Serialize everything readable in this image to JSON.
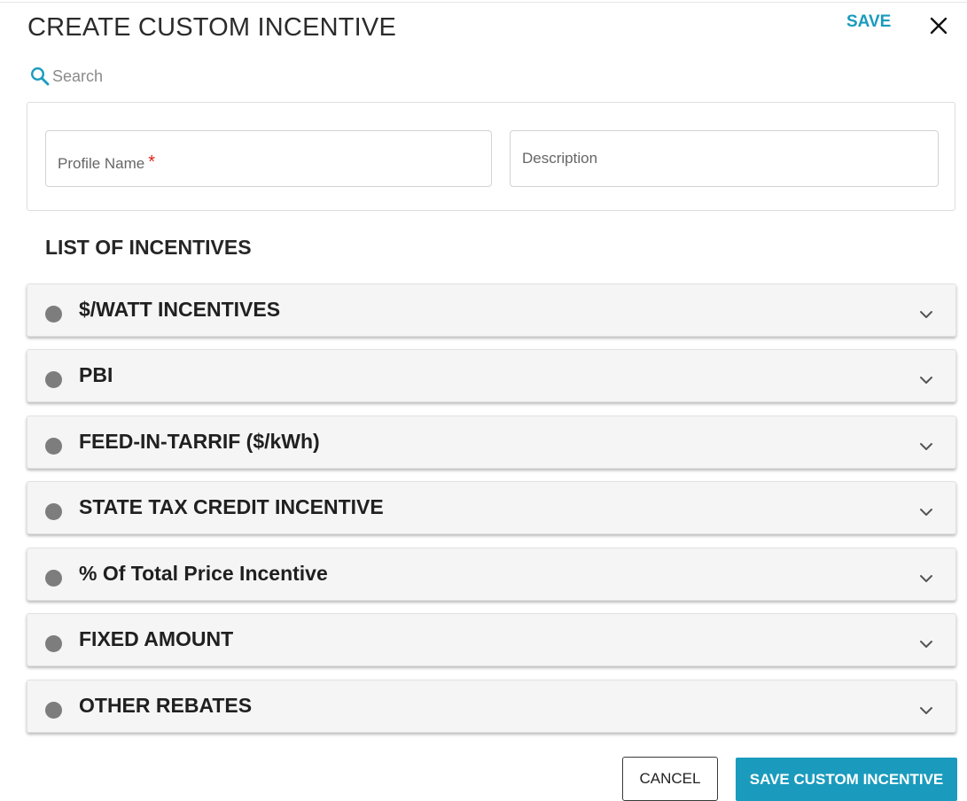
{
  "header": {
    "title": "CREATE CUSTOM INCENTIVE",
    "save_label": "SAVE"
  },
  "search": {
    "placeholder": "Search",
    "value": ""
  },
  "form": {
    "profile_name_label": "Profile Name",
    "required_marker": "*",
    "description_label": "Description"
  },
  "incentives": {
    "heading": "LIST OF INCENTIVES",
    "items": [
      {
        "label": "$/WATT INCENTIVES"
      },
      {
        "label": "PBI"
      },
      {
        "label": "FEED-IN-TARRIF ($/kWh)"
      },
      {
        "label": "STATE TAX CREDIT INCENTIVE"
      },
      {
        "label": "% Of Total Price Incentive"
      },
      {
        "label": "FIXED AMOUNT"
      },
      {
        "label": "OTHER REBATES"
      }
    ]
  },
  "footer": {
    "cancel_label": "CANCEL",
    "save_custom_label": "SAVE CUSTOM INCENTIVE"
  },
  "colors": {
    "accent": "#1a9bbd",
    "required": "#e0201a",
    "status_dot": "#7d7d7d",
    "accordion_bg": "#f5f5f5"
  },
  "icons": {
    "close": "close-icon",
    "search": "search-icon",
    "expand": "chevron-down-icon",
    "status": "status-dot-icon"
  }
}
